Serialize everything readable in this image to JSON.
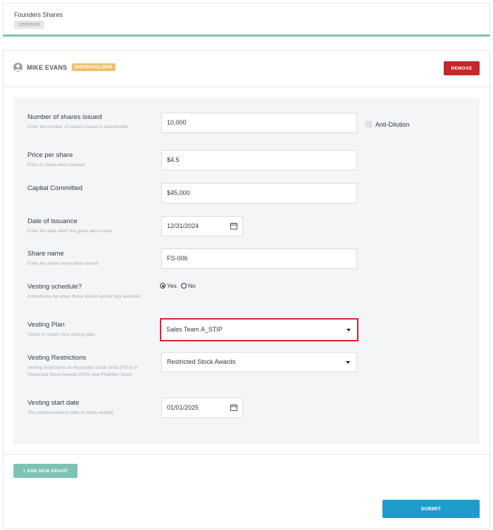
{
  "top": {
    "title": "Founders Shares",
    "badge": "common"
  },
  "holder": {
    "name": "MIKE EVANS",
    "tag": "SHAREHOLDER",
    "remove_label": "REMOVE"
  },
  "fields": {
    "shares": {
      "label": "Number of shares issued",
      "help": "Enter the number of shares issued to shareholder",
      "value": "10,000"
    },
    "anti_dilution": {
      "label": "Anti-Dilution",
      "checked": false
    },
    "price": {
      "label": "Price per share",
      "help": "Price of share when created",
      "value": "$4.5"
    },
    "capital": {
      "label": "Capital Committed",
      "value": "$45,000"
    },
    "date": {
      "label": "Date of issuance",
      "help": "Enter the date when the grant was issued",
      "value": "12/31/2024"
    },
    "share_name": {
      "label": "Share name",
      "help": "Enter the share name when issued",
      "value": "FS-006"
    },
    "vesting_schedule": {
      "label": "Vesting schedule?",
      "help": "A timeframe for when these shares will be fully awarded",
      "yes": "Yes",
      "no": "No",
      "selected": "Yes"
    },
    "vesting_plan": {
      "label": "Vesting Plan",
      "help": "Select or create new vesting plan.",
      "value": "Sales Team A_STIP"
    },
    "restrictions": {
      "label": "Vesting Restrictions",
      "help": "Vesting restrictions as Restricted Stock Units (RSU) or Restricted Stock Awards (RSA) and Phantom Stock",
      "value": "Restricted Stock Awards"
    },
    "start_date": {
      "label": "Vesting start date",
      "help": "The commencement date of share vesting",
      "value": "01/01/2025"
    }
  },
  "actions": {
    "add_grant": "+ ADD NEW GRANT",
    "submit": "SUBMIT"
  },
  "colors": {
    "accent_teal": "#7dc3b4",
    "remove_red": "#c6272b",
    "submit_blue": "#1e9ccb",
    "tag_orange": "#f0bf72",
    "highlight_red": "#e0202a"
  }
}
